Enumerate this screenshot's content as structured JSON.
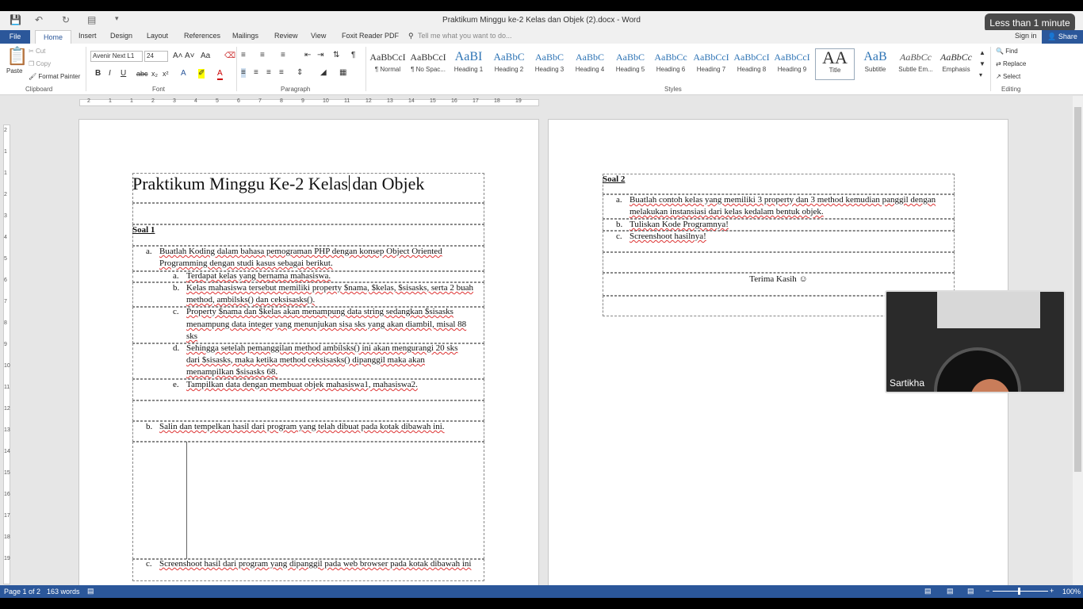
{
  "window": {
    "title": "Praktikum Minggu ke-2 Kelas dan Objek (2).docx - Word"
  },
  "toast": "Less than 1 minute",
  "tabs": [
    "File",
    "Home",
    "Insert",
    "Design",
    "Layout",
    "References",
    "Mailings",
    "Review",
    "View",
    "Foxit Reader PDF"
  ],
  "tell_me": "Tell me what you want to do...",
  "account": {
    "sign_in": "Sign in",
    "share": "Share"
  },
  "clipboard": {
    "paste": "Paste",
    "cut": "Cut",
    "copy": "Copy",
    "format_painter": "Format Painter",
    "label": "Clipboard"
  },
  "font": {
    "name": "Avenir Next L1",
    "size": "24",
    "label": "Font"
  },
  "paragraph": {
    "label": "Paragraph"
  },
  "styles": {
    "label": "Styles",
    "items": [
      {
        "preview": "AaBbCcI",
        "name": "¶ Normal"
      },
      {
        "preview": "AaBbCcI",
        "name": "¶ No Spac..."
      },
      {
        "preview": "AaBI",
        "name": "Heading 1"
      },
      {
        "preview": "AaBbC",
        "name": "Heading 2"
      },
      {
        "preview": "AaBbC",
        "name": "Heading 3"
      },
      {
        "preview": "AaBbC",
        "name": "Heading 4"
      },
      {
        "preview": "AaBbC",
        "name": "Heading 5"
      },
      {
        "preview": "AaBbCc",
        "name": "Heading 6"
      },
      {
        "preview": "AaBbCcI",
        "name": "Heading 7"
      },
      {
        "preview": "AaBbCcI",
        "name": "Heading 8"
      },
      {
        "preview": "AaBbCcI",
        "name": "Heading 9"
      },
      {
        "preview": "AA",
        "name": "Title"
      },
      {
        "preview": "AaB",
        "name": "Subtitle"
      },
      {
        "preview": "AaBbCc",
        "name": "Subtle Em..."
      },
      {
        "preview": "AaBbCc",
        "name": "Emphasis"
      }
    ]
  },
  "editing": {
    "find": "Find",
    "replace": "Replace",
    "select": "Select",
    "label": "Editing"
  },
  "ruler_numbers": [
    "2",
    "1",
    "1",
    "2",
    "3",
    "4",
    "5",
    "6",
    "7",
    "8",
    "9",
    "10",
    "11",
    "12",
    "13",
    "14",
    "15",
    "16",
    "17",
    "18",
    "19"
  ],
  "vruler_numbers": [
    "2",
    "1",
    "1",
    "2",
    "3",
    "4",
    "5",
    "6",
    "7",
    "8",
    "9",
    "10",
    "11",
    "12",
    "13",
    "14",
    "15",
    "16",
    "17",
    "18",
    "19"
  ],
  "page1": {
    "title": "Praktikum Minggu Ke-2 Kelas dan Objek",
    "soal1": "Soal 1",
    "a_marker": "a.",
    "a_line1": "Buatlah Koding dalam bahasa pemograman PHP dengan konsep Object Oriented",
    "a_line2": "Programming dengan studi kasus sebagai berikut.",
    "sub": [
      {
        "marker": "a.",
        "lines": [
          "Terdapat kelas yang bernama mahasiswa."
        ]
      },
      {
        "marker": "b.",
        "lines": [
          "Kelas mahasiswa tersebut memiliki property $nama, $kelas, $sisasks, serta 2 buah",
          "method, ambilsks() dan ceksisasks()."
        ]
      },
      {
        "marker": "c.",
        "lines": [
          "Property $nama dan $kelas akan menampung data string sedangkan $sisasks",
          "menampung data integer yang menunjukan sisa sks yang akan diambil, misal 88",
          "sks"
        ]
      },
      {
        "marker": "d.",
        "lines": [
          "Sehingga setelah pemanggilan method ambilsks()  ini akan mengurangi 20 sks",
          "dari $sisasks, maka ketika method ceksisasks() dipanggil maka akan",
          "menampilkan $sisasks 68."
        ]
      },
      {
        "marker": "e.",
        "lines": [
          "Tampilkan data dengan membuat objek mahasiswa1, mahasiswa2."
        ]
      }
    ],
    "b_marker": "b.",
    "b_text": "Salin dan tempelkan hasil dari program yang telah dibuat pada kotak dibawah ini.",
    "c_marker": "c.",
    "c_text": "Screenshoot hasil dari program yang dipanggil pada web browser pada kotak dibawah ini"
  },
  "page2": {
    "soal2": "Soal 2",
    "items": [
      {
        "marker": "a.",
        "lines": [
          "Buatlah contoh kelas yang memiliki 3 property dan 3 method kemudian panggil dengan",
          "melakukan instansiasi dari kelas kedalam bentuk objek."
        ]
      },
      {
        "marker": "b.",
        "lines": [
          "Tuliskan Kode Programnya!"
        ]
      },
      {
        "marker": "c.",
        "lines": [
          "Screenshoot hasilnya!"
        ]
      }
    ],
    "thanks": "Terima Kasih ☺"
  },
  "video": {
    "participant": "Sartikha"
  },
  "status": {
    "page": "Page 1 of 2",
    "words": "163 words",
    "zoom": "100%"
  }
}
